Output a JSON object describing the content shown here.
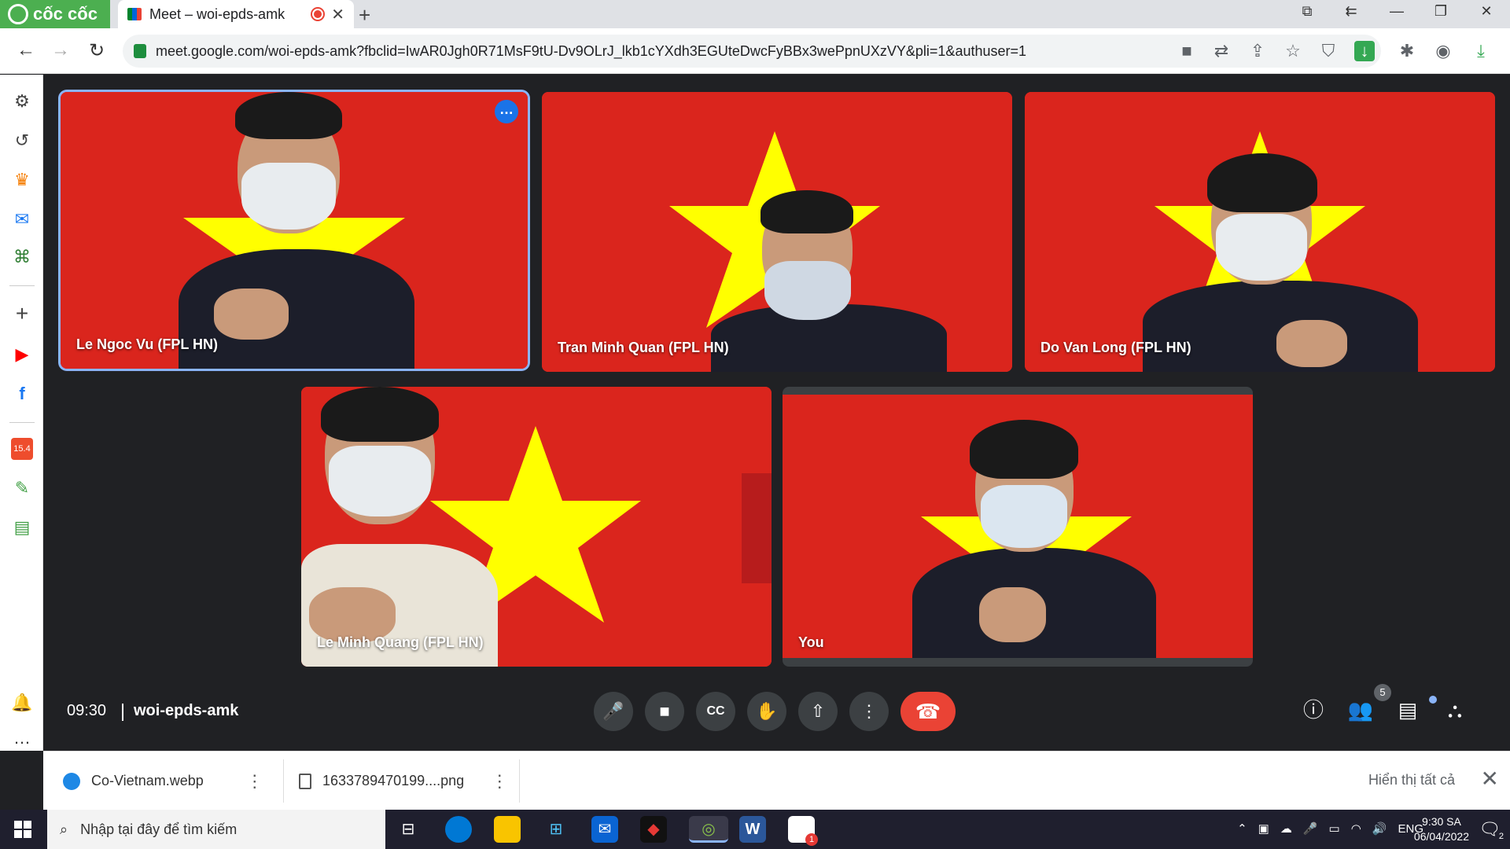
{
  "browser": {
    "brand": "cốc cốc",
    "tab_title": "Meet – woi-epds-amk",
    "url": "meet.google.com/woi-epds-amk?fbclid=IwAR0Jgh0R71MsF9tU-Dv9OLrJ_lkb1cYXdh3EGUteDwcFyBBx3wePpnUXzVY&pli=1&authuser=1"
  },
  "sidebar": {
    "items": [
      "settings-icon",
      "history-icon",
      "crown-icon",
      "messenger-icon",
      "gamepad-icon",
      "add-icon",
      "youtube-icon",
      "facebook-icon",
      "shopee-icon",
      "lottery-icon",
      "sheet-icon",
      "bell-icon",
      "more-icon"
    ],
    "shopee_badge": "15.4"
  },
  "meet": {
    "participants": [
      {
        "name": "Le Ngoc Vu (FPL HN)"
      },
      {
        "name": "Tran Minh Quan (FPL HN)"
      },
      {
        "name": "Do Van Long (FPL HN)"
      },
      {
        "name": "Le Minh Quang (FPL HN)"
      },
      {
        "name": "You"
      }
    ],
    "time": "09:30",
    "code": "woi-epds-amk",
    "people_count": "5",
    "colors": {
      "flag_red": "#da251d",
      "star_yellow": "#ffff00",
      "end_call": "#ea4335",
      "active_border": "#8ab4f8"
    }
  },
  "downloads": {
    "items": [
      {
        "name": "Co-Vietnam.webp"
      },
      {
        "name": "1633789470199....png"
      }
    ],
    "show_all": "Hiển thị tất cả"
  },
  "taskbar": {
    "search_placeholder": "Nhập tại đây để tìm kiếm",
    "lang": "ENG",
    "time": "9:30 SA",
    "date": "06/04/2022",
    "notif_count": "2",
    "zalo_badge": "1"
  }
}
